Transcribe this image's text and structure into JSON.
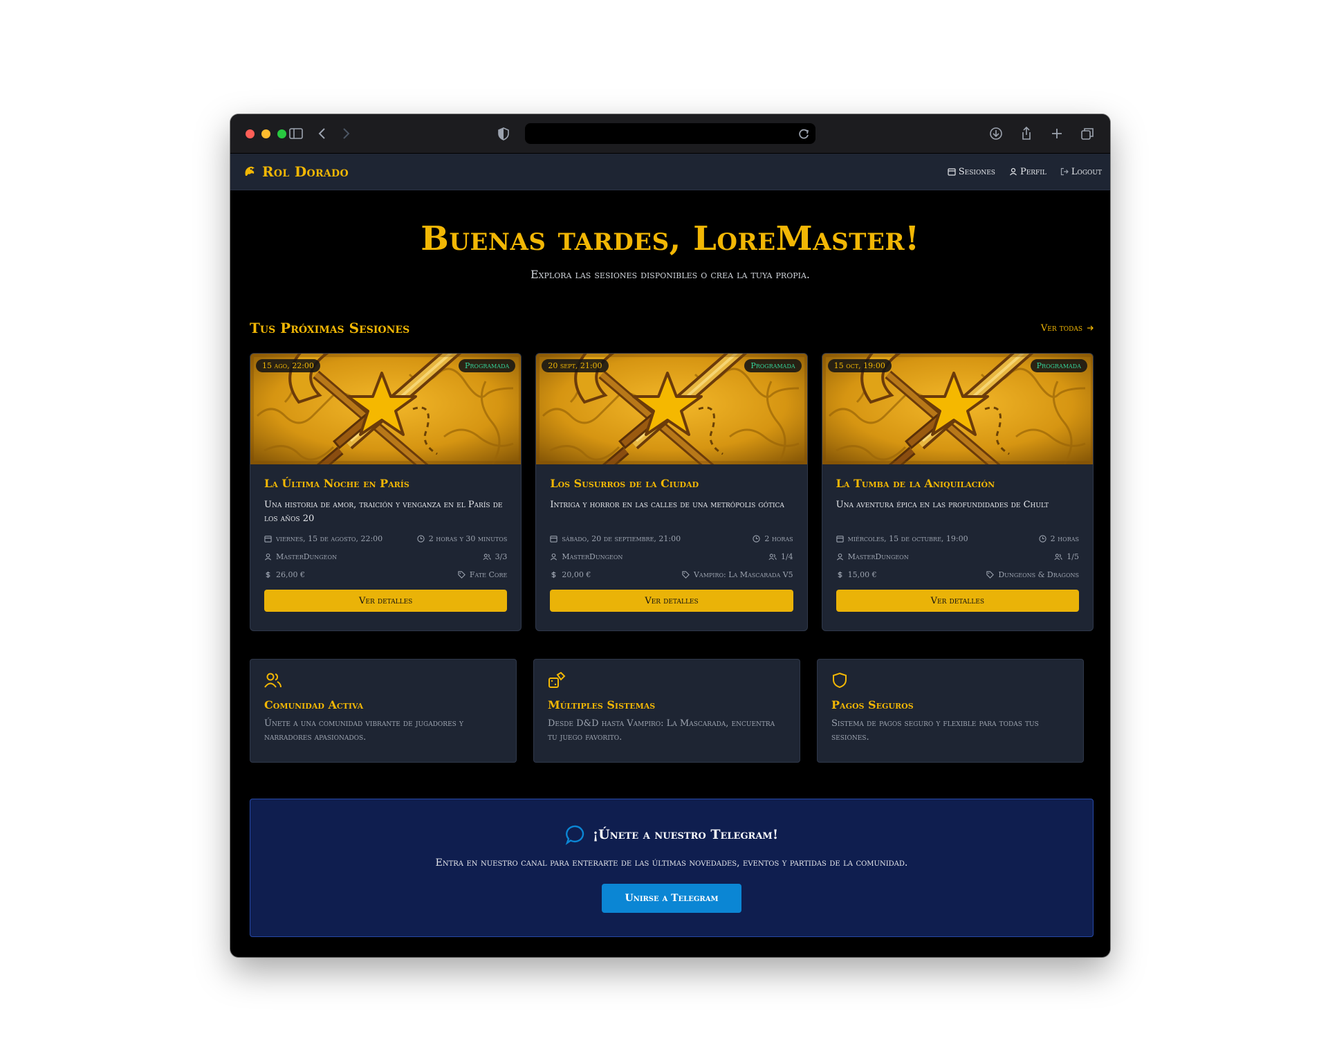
{
  "nav": {
    "brand": "Rol Dorado",
    "links": [
      "Sesiones",
      "Perfil",
      "Logout"
    ]
  },
  "hero": {
    "title": "Buenas tardes, LoreMaster!",
    "subtitle": "Explora las sesiones disponibles o crea la tuya propia."
  },
  "sessions_section": {
    "title": "Tus Próximas Sesiones",
    "view_all": "Ver todas"
  },
  "sessions": [
    {
      "date_badge": "15 ago, 22:00",
      "status": "Programada",
      "title": "La Última Noche en París",
      "description": "Una historia de amor, traición y venganza en el París de los años 20",
      "date": "viernes, 15 de agosto, 22:00",
      "duration": "2 horas y 30 minutos",
      "master": "MasterDungeon",
      "players": "3/3",
      "price": "26,00 €",
      "system": "Fate Core",
      "button": "Ver detalles"
    },
    {
      "date_badge": "20 sept, 21:00",
      "status": "Programada",
      "title": "Los Susurros de la Ciudad",
      "description": "Intriga y horror en las calles de una metrópolis gótica",
      "date": "sábado, 20 de septiembre, 21:00",
      "duration": "2 horas",
      "master": "MasterDungeon",
      "players": "1/4",
      "price": "20,00 €",
      "system": "Vampiro: La Mascarada V5",
      "button": "Ver detalles"
    },
    {
      "date_badge": "15 oct, 19:00",
      "status": "Programada",
      "title": "La Tumba de la Aniquilación",
      "description": "Una aventura épica en las profundidades de Chult",
      "date": "miércoles, 15 de octubre, 19:00",
      "duration": "2 horas",
      "master": "MasterDungeon",
      "players": "1/5",
      "price": "15,00 €",
      "system": "Dungeons & Dragons",
      "button": "Ver detalles"
    }
  ],
  "features": [
    {
      "icon": "users-icon",
      "title": "Comunidad Activa",
      "text": "Únete a una comunidad vibrante de jugadores y narradores apasionados."
    },
    {
      "icon": "dice-icon",
      "title": "Múltiples Sistemas",
      "text": "Desde D&D hasta Vampiro: La Mascarada, encuentra tu juego favorito."
    },
    {
      "icon": "shield-icon",
      "title": "Pagos Seguros",
      "text": "Sistema de pagos seguro y flexible para todas tus sesiones."
    }
  ],
  "telegram": {
    "title": "¡Únete a nuestro Telegram!",
    "description": "Entra en nuestro canal para enterarte de las últimas novedades, eventos y partidas de la comunidad.",
    "button": "Unirse a Telegram"
  },
  "colors": {
    "accent": "#f2b705",
    "background": "#000000",
    "card": "#1e2533",
    "status": "#34d399",
    "telegram_bg": "#0f1e4f",
    "telegram_button": "#0b86d4"
  }
}
